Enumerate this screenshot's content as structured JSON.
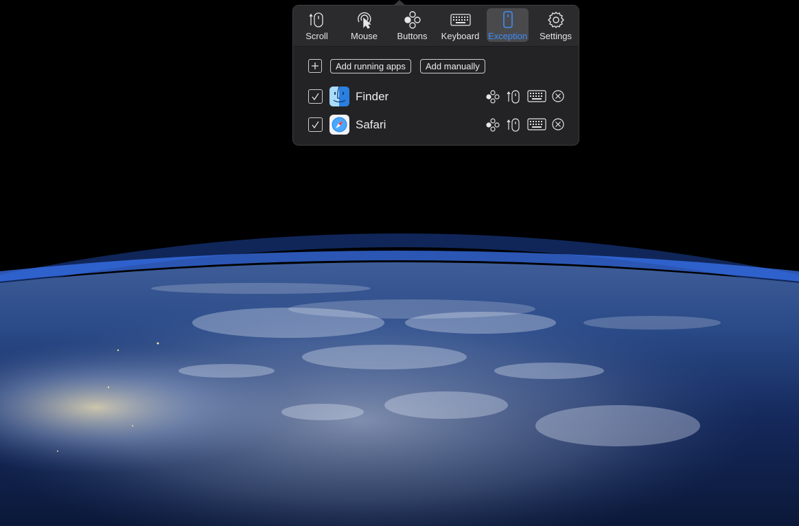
{
  "toolbar": {
    "tabs": [
      {
        "label": "Scroll",
        "icon": "scroll-icon"
      },
      {
        "label": "Mouse",
        "icon": "mouse-icon"
      },
      {
        "label": "Buttons",
        "icon": "buttons-icon"
      },
      {
        "label": "Keyboard",
        "icon": "keyboard-icon"
      },
      {
        "label": "Exception",
        "icon": "exception-icon",
        "selected": true
      },
      {
        "label": "Settings",
        "icon": "gear-icon"
      }
    ]
  },
  "actions": {
    "add_running_label": "Add running apps",
    "add_manually_label": "Add manually"
  },
  "apps": [
    {
      "name": "Finder",
      "enabled": true,
      "icon": "finder-app-icon"
    },
    {
      "name": "Safari",
      "enabled": true,
      "icon": "safari-app-icon"
    }
  ],
  "colors": {
    "accent": "#3e8ef7",
    "panel_background": "#232325",
    "toolbar_background": "#2b2b2d",
    "selected_tab": "#4a4a4d"
  }
}
